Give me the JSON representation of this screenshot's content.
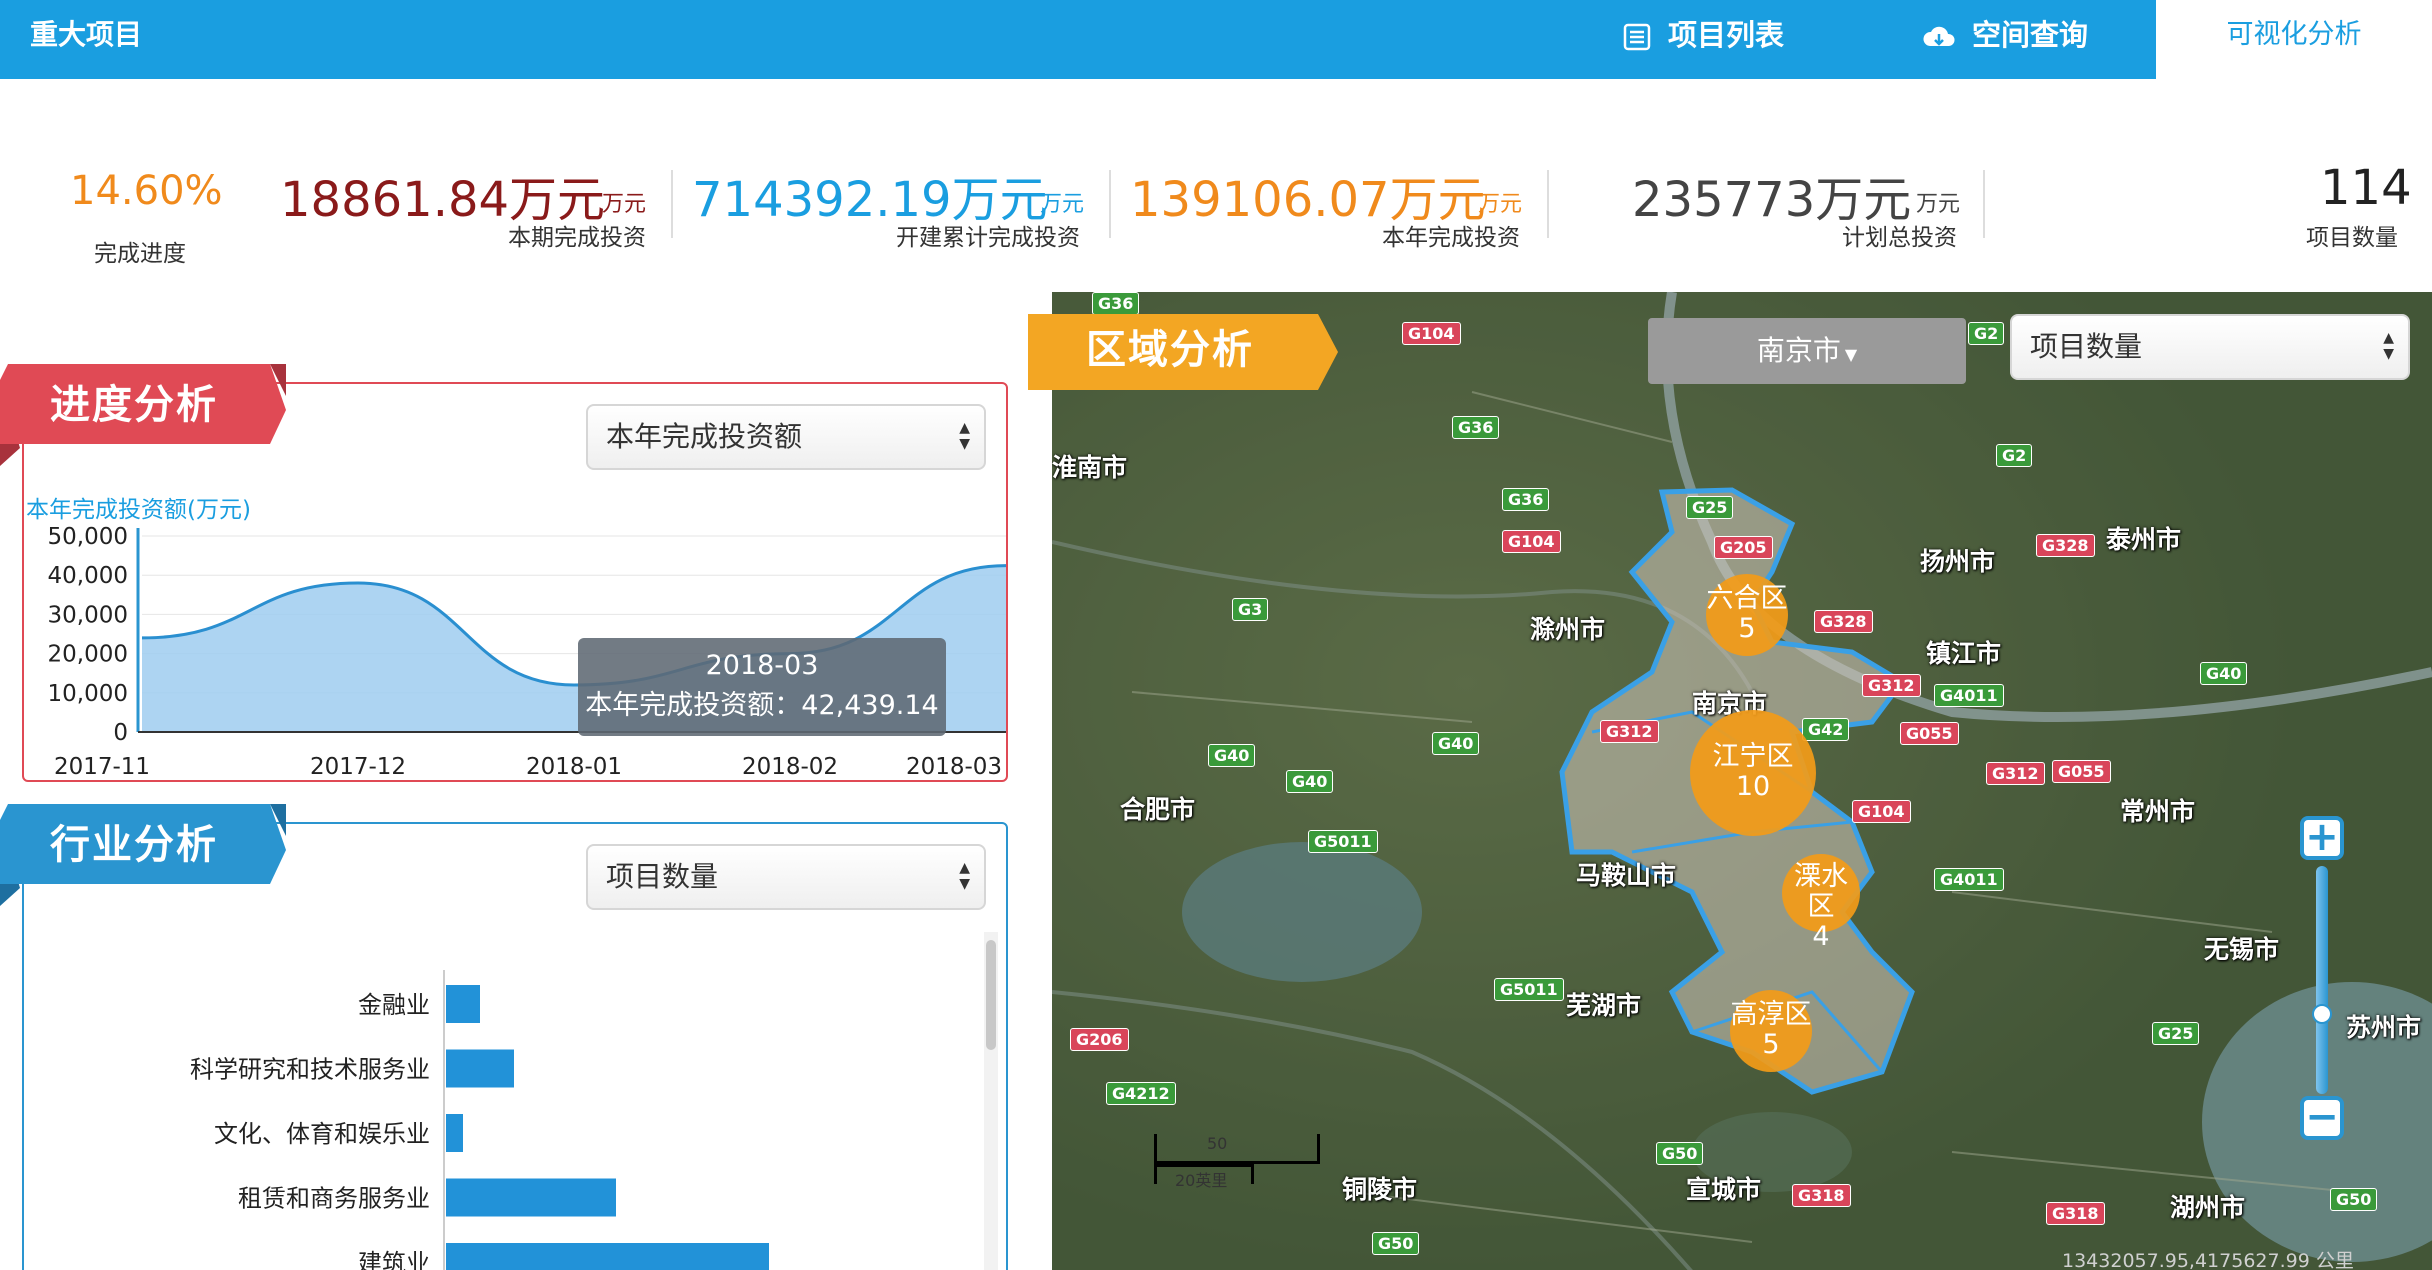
{
  "header": {
    "title": "重大项目",
    "nav": [
      {
        "label": "项目列表",
        "icon": "list-icon"
      },
      {
        "label": "空间查询",
        "icon": "cloud-icon"
      }
    ],
    "active_tab": "可视化分析"
  },
  "stats": {
    "progress_value": "14.60%",
    "progress_label": "完成进度",
    "period_value": "18861.84万元",
    "period_unit": "万元",
    "period_label": "本期完成投资",
    "cumulative_value": "714392.19万元",
    "cumulative_unit": "万元",
    "cumulative_label": "开建累计完成投资",
    "year_value": "139106.07万元",
    "year_unit": "万元",
    "year_label": "本年完成投资",
    "plan_value": "235773万元",
    "plan_unit": "万元",
    "plan_label": "计划总投资",
    "count_value": "114",
    "count_label": "项目数量"
  },
  "progress_panel": {
    "title": "进度分析",
    "select_value": "本年完成投资额",
    "y_axis_title": "本年完成投资额(万元)",
    "tooltip_date": "2018-03",
    "tooltip_text": "本年完成投资额：42,439.14"
  },
  "industry_panel": {
    "title": "行业分析",
    "select_value": "项目数量"
  },
  "region_panel": {
    "title": "区域分析",
    "city_select": "南京市",
    "metric_select": "项目数量"
  },
  "map": {
    "clusters": [
      {
        "name": "六合区",
        "count": "5"
      },
      {
        "name": "江宁区",
        "count": "10"
      },
      {
        "name": "溧水区",
        "count": "4"
      },
      {
        "name": "高淳区",
        "count": "5"
      }
    ],
    "cities": [
      "淮南市",
      "扬州市",
      "泰州市",
      "滁州市",
      "镇江市",
      "南京市",
      "合肥市",
      "常州市",
      "马鞍山市",
      "无锡市",
      "芜湖市",
      "苏州市",
      "铜陵市",
      "宣城市",
      "湖州市"
    ],
    "roads_red": [
      "G104",
      "G104",
      "G205",
      "G328",
      "G328",
      "G312",
      "G312",
      "G055",
      "G312",
      "G055",
      "G104",
      "G206",
      "G318",
      "G318"
    ],
    "roads_green": [
      "G36",
      "G36",
      "G36",
      "G2",
      "G2",
      "G25",
      "G3",
      "G40",
      "G4011",
      "G40",
      "G40",
      "G40",
      "G5011",
      "G4011",
      "G5011",
      "G25",
      "G4212",
      "G50",
      "G50",
      "G50",
      "G42"
    ],
    "scale_top": "50",
    "scale_bottom": "20英里",
    "coords": "13432057.95,4175627.99 公里"
  },
  "chart_data": [
    {
      "type": "area",
      "x": [
        "2017-11",
        "2017-12",
        "2018-01",
        "2018-02",
        "2018-03"
      ],
      "values": [
        24000,
        38000,
        12000,
        20000,
        42439.14
      ],
      "ylabel": "本年完成投资额(万元)",
      "yticks": [
        "0",
        "10,000",
        "20,000",
        "30,000",
        "40,000",
        "50,000"
      ],
      "ylim": [
        0,
        50000
      ]
    },
    {
      "type": "bar",
      "categories": [
        "金融业",
        "科学研究和技术服务业",
        "文化、体育和娱乐业",
        "租赁和商务服务业",
        "建筑业"
      ],
      "values": [
        2,
        4,
        1,
        10,
        19
      ]
    }
  ]
}
